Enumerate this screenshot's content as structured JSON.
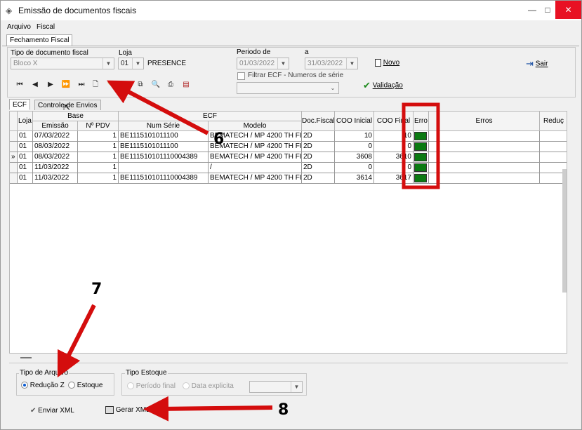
{
  "window": {
    "title": "Emissão de documentos fiscais",
    "minimize": "—",
    "maximize": "□",
    "close": "✕"
  },
  "menu": [
    "Arquivo",
    "Fiscal"
  ],
  "main_tab": "Fechamento Fiscal",
  "form": {
    "tipo_doc_label": "Tipo de documento fiscal",
    "tipo_doc_value": "Bloco X",
    "loja_label": "Loja",
    "loja_value": "01",
    "loja_name": "PRESENCE",
    "periodo_label": "Periodo  de",
    "periodo_a_label": "a",
    "periodo_de": "01/03/2022",
    "periodo_ate": "31/03/2022",
    "filtrar_label": "Filtrar ECF - Numeros de  série",
    "novo_label": "Novo",
    "sair_label": "Sair",
    "validacao_label": "Validação"
  },
  "sub_tabs": [
    "ECF",
    "Controle de Envios"
  ],
  "grid": {
    "group_headers": [
      "Base",
      "ECF"
    ],
    "columns": [
      "Loja",
      "Emissão",
      "Nº PDV",
      "Num Série",
      "Modelo",
      "Doc.Fiscal",
      "COO Inicial",
      "COO Final",
      "Erro",
      "Erros",
      "Reduç"
    ],
    "rows": [
      {
        "marker": "",
        "loja": "01",
        "emissao": "07/03/2022",
        "pdv": "1",
        "serie": "BE1115101011100",
        "modelo": "BEMATECH / MP 4200 TH FI",
        "doc": "2D",
        "coo_ini": "10",
        "coo_fim": "10"
      },
      {
        "marker": "",
        "loja": "01",
        "emissao": "08/03/2022",
        "pdv": "1",
        "serie": "BE1115101011100",
        "modelo": "BEMATECH / MP 4200 TH FI",
        "doc": "2D",
        "coo_ini": "0",
        "coo_fim": "0"
      },
      {
        "marker": "»",
        "loja": "01",
        "emissao": "08/03/2022",
        "pdv": "1",
        "serie": "BE111510101110004389",
        "modelo": "BEMATECH / MP 4200 TH FI",
        "doc": "2D",
        "coo_ini": "3608",
        "coo_fim": "3610"
      },
      {
        "marker": "",
        "loja": "01",
        "emissao": "11/03/2022",
        "pdv": "1",
        "serie": "",
        "modelo": "/",
        "doc": "2D",
        "coo_ini": "0",
        "coo_fim": "0"
      },
      {
        "marker": "",
        "loja": "01",
        "emissao": "11/03/2022",
        "pdv": "1",
        "serie": "BE111510101110004389",
        "modelo": "BEMATECH / MP 4200 TH FI",
        "doc": "2D",
        "coo_ini": "3614",
        "coo_fim": "3617"
      }
    ]
  },
  "tipo_arquivo": {
    "title": "Tipo de Arquivo",
    "options": [
      "Redução Z",
      "Estoque"
    ],
    "selected": "Redução Z"
  },
  "tipo_estoque": {
    "title": "Tipo Estoque",
    "options": [
      "Período final",
      "Data explicita"
    ]
  },
  "buttons": {
    "enviar_xml": "Enviar XML",
    "gerar_xml": "Gerar XML"
  },
  "annotations": [
    "6",
    "7",
    "8"
  ],
  "colors": {
    "highlight": "#d40d0d",
    "error_green": "#0b7a12"
  }
}
